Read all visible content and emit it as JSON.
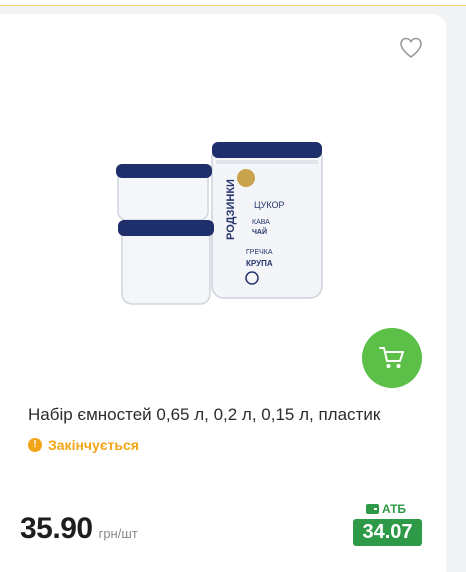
{
  "product": {
    "title": "Набір ємностей 0,65 л, 0,2 л, 0,15 л, пластик",
    "status": "Закінчується",
    "status_icon": "exclamation-icon",
    "price": "35.90",
    "unit": "грн/шт",
    "card_label": "АТБ",
    "card_price": "34.07",
    "image_labels": [
      "ЦУКОР",
      "РОДЗИНКИ",
      "КАВА",
      "ЧАЙ",
      "ГРЕЧКА",
      "КРУПА"
    ]
  },
  "icons": {
    "favorite": "heart-outline-icon",
    "cart": "shopping-cart-icon",
    "card": "wallet-icon"
  },
  "colors": {
    "accent_green": "#5bbf48",
    "atb_green": "#2e9a48",
    "warning_orange": "#f2a516",
    "container_lid": "#1f2f6b"
  }
}
